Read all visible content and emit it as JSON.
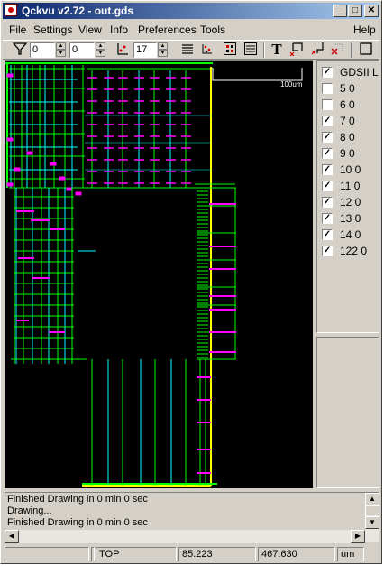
{
  "window": {
    "title": "Qckvu v2.72 - out.gds",
    "min_glyph": "_",
    "max_glyph": "□",
    "close_glyph": "✕"
  },
  "menu": {
    "file": "File",
    "settings": "Settings",
    "view": "View",
    "info": "Info",
    "preferences": "Preferences",
    "tools": "Tools",
    "help": "Help"
  },
  "toolbar": {
    "filter_min": "0",
    "filter_max": "0",
    "depth": "17",
    "text_tool_glyph": "T"
  },
  "canvas": {
    "scale_label": "100um",
    "colors": {
      "green": "#00ff00",
      "cyan": "#00ffff",
      "magenta": "#ff00ff",
      "yellow": "#ffff00",
      "white": "#ffffff"
    }
  },
  "layers": {
    "header": "GDSII La",
    "items": [
      {
        "label": "5  0",
        "checked": false
      },
      {
        "label": "6  0",
        "checked": false
      },
      {
        "label": "7  0",
        "checked": true
      },
      {
        "label": "8  0",
        "checked": true
      },
      {
        "label": "9  0",
        "checked": true
      },
      {
        "label": "10  0",
        "checked": true
      },
      {
        "label": "11  0",
        "checked": true
      },
      {
        "label": "12  0",
        "checked": true
      },
      {
        "label": "13  0",
        "checked": true
      },
      {
        "label": "14  0",
        "checked": true
      },
      {
        "label": "122  0",
        "checked": true
      }
    ]
  },
  "log": {
    "lines": [
      "Finished Drawing in 0 min 0 sec",
      "Drawing...",
      "Finished Drawing in 0 min 0 sec"
    ]
  },
  "status": {
    "cell": "TOP",
    "x": "85.223",
    "y": "467.630",
    "unit": "um"
  }
}
